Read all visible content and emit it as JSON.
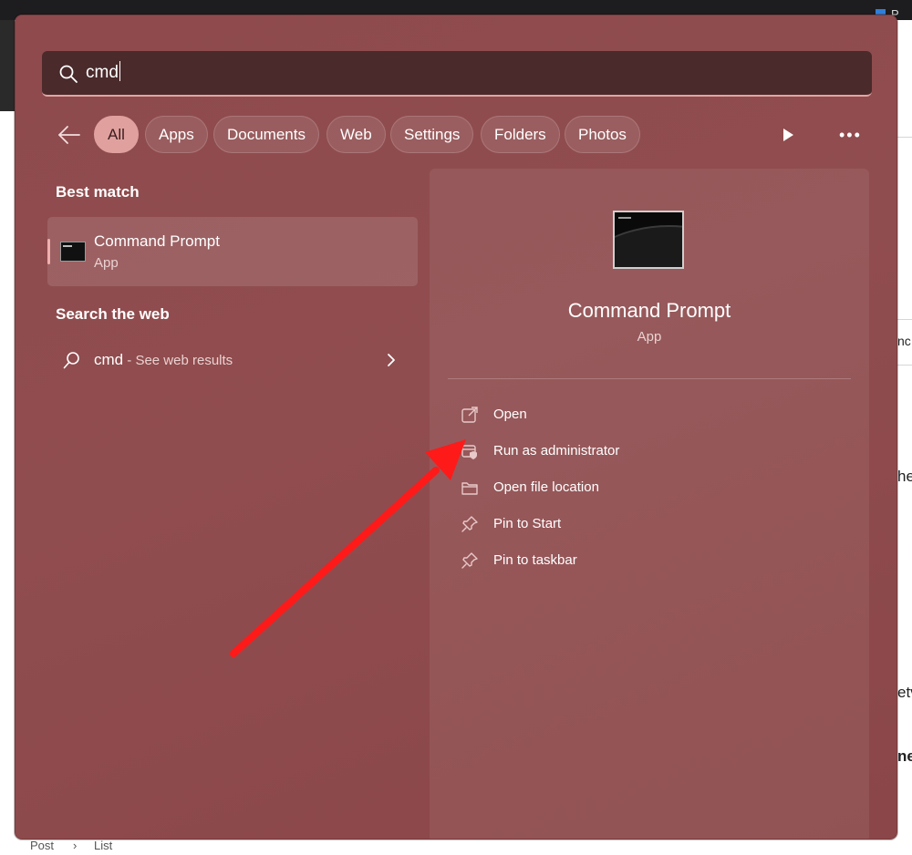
{
  "background": {
    "top_right_label": "P",
    "right_edge_texts": [
      "nc",
      "he",
      "etv",
      "ne"
    ],
    "breadcrumb": [
      "Post",
      "List"
    ]
  },
  "search": {
    "value": "cmd"
  },
  "filters": {
    "items": [
      "All",
      "Apps",
      "Documents",
      "Web",
      "Settings",
      "Folders",
      "Photos"
    ],
    "active": "All",
    "more_label": "•••"
  },
  "best_match": {
    "heading": "Best match",
    "name": "Command Prompt",
    "type": "App"
  },
  "search_web": {
    "heading": "Search the web",
    "query": "cmd",
    "suffix": " - See web results"
  },
  "detail": {
    "name": "Command Prompt",
    "type": "App",
    "actions": [
      {
        "label": "Open",
        "icon": "open-external-icon"
      },
      {
        "label": "Run as administrator",
        "icon": "shield-admin-icon"
      },
      {
        "label": "Open file location",
        "icon": "folder-icon"
      },
      {
        "label": "Pin to Start",
        "icon": "pin-icon"
      },
      {
        "label": "Pin to taskbar",
        "icon": "pin-icon"
      }
    ]
  },
  "colors": {
    "flyout_bg": "#8e4a4c",
    "active_chip": "#e0a19e",
    "annotation_arrow": "#ff1a1a"
  }
}
